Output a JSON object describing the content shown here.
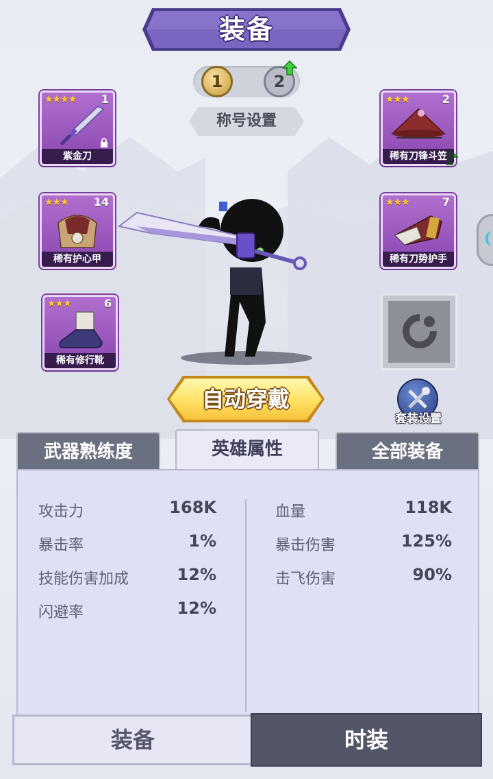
{
  "header": {
    "title": "装备"
  },
  "page_switch": {
    "pages": [
      "1",
      "2"
    ],
    "active": "1"
  },
  "title_setting": {
    "label": "称号设置"
  },
  "slots": {
    "weapon": {
      "stars": "★★★★",
      "level": "1",
      "name": "紫金刀",
      "locked": true
    },
    "cape": {
      "stars": "★★★",
      "level": "2",
      "name": "稀有刀锋斗笠",
      "upgradable": true
    },
    "armor": {
      "stars": "★★★",
      "level": "14",
      "name": "稀有护心甲"
    },
    "gloves": {
      "stars": "★★★",
      "level": "7",
      "name": "稀有刀势护手"
    },
    "boots": {
      "stars": "★★★",
      "level": "6",
      "name": "稀有修行靴"
    },
    "empty": {
      "icon": "ring-slot-icon"
    }
  },
  "auto_equip": {
    "label": "自动穿戴"
  },
  "suit_setting": {
    "label": "套装设置"
  },
  "tabs": [
    {
      "label": "武器熟练度"
    },
    {
      "label": "英雄属性"
    },
    {
      "label": "全部装备"
    }
  ],
  "active_tab": "英雄属性",
  "stats": {
    "left": [
      {
        "label": "攻击力",
        "value": "168K"
      },
      {
        "label": "暴击率",
        "value": "1%"
      },
      {
        "label": "技能伤害加成",
        "value": "12%"
      },
      {
        "label": "闪避率",
        "value": "12%"
      }
    ],
    "right": [
      {
        "label": "血量",
        "value": "118K"
      },
      {
        "label": "暴击伤害",
        "value": "125%"
      },
      {
        "label": "击飞伤害",
        "value": "90%"
      }
    ]
  },
  "bottom_nav": [
    {
      "label": "装备"
    },
    {
      "label": "时装"
    }
  ],
  "colors": {
    "banner": "#6f5bb3",
    "slot_purple": "#9b55c0",
    "auto_button": "#ffd84a",
    "panel": "#dfdff6"
  }
}
